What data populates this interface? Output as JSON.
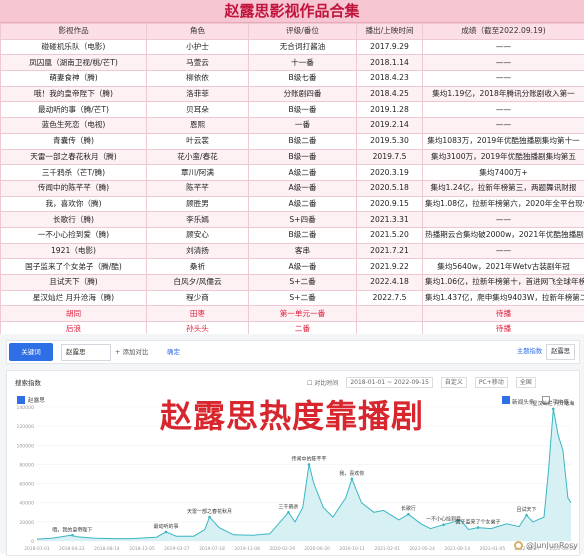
{
  "table": {
    "title": "赵露思影视作品合集",
    "headers": [
      "影视作品",
      "角色",
      "评级/番位",
      "播出/上映时间",
      "成绩（截至2022.09.19)"
    ],
    "rows": [
      [
        "碰碰机乐队（电影)",
        "小护士",
        "无合词打酱油",
        "2017.9.29",
        "——",
        ""
      ],
      [
        "凤囚凰（湖南卫视/桃/芒T)",
        "马萱云",
        "十一番",
        "2018.1.14",
        "——",
        ""
      ],
      [
        "萌妻食神（腾)",
        "柳依依",
        "B级七番",
        "2018.4.23",
        "——",
        ""
      ],
      [
        "哦！我的皇帝陛下（腾)",
        "洛菲菲",
        "分账剧四番",
        "2018.4.25",
        "集均1.19亿，2018年腾讯分账剧收入第一",
        ""
      ],
      [
        "最动听的事（腾/芒T)",
        "贝耳朵",
        "B级一番",
        "2019.1.28",
        "——",
        ""
      ],
      [
        "蓝色生死恋（电视)",
        "恩熙",
        "一番",
        "2019.2.14",
        "——",
        ""
      ],
      [
        "青囊传（腾)",
        "叶云裳",
        "B级二番",
        "2019.5.30",
        "集均1083万，2019年优酷独播剧集均第十一",
        ""
      ],
      [
        "天雷一部之春花秋月（腾)",
        "花小蛮/春花",
        "B级一番",
        "2019.7.5",
        "集均3100万，2019年优酷独播剧集均第五",
        ""
      ],
      [
        "三千鸦杀（芒T/腾)",
        "覃川/阿满",
        "A级二番",
        "2020.3.19",
        "集均7400万+",
        ""
      ],
      [
        "传闻中的陈芊芊（腾)",
        "陈芊芊",
        "A级一番",
        "2020.5.18",
        "集均1.24亿，拉新年榜第三，两题舞讯财报",
        ""
      ],
      [
        "我，喜欢你（腾)",
        "顾胜男",
        "A级二番",
        "2020.9.15",
        "集均1.08亿，拉新年榜第六，2020年全平台现偶年冠",
        ""
      ],
      [
        "长歌行（腾)",
        "李乐嫣",
        "S+四番",
        "2021.3.31",
        "——",
        ""
      ],
      [
        "一不小心捡到爱（腾)",
        "顾安心",
        "B级二番",
        "2021.5.20",
        "热播期云合集均破2000w，2021年优酷独播剧热播期集均第三",
        ""
      ],
      [
        "1921（电影)",
        "刘清扬",
        "客串",
        "2021.7.21",
        "——",
        ""
      ],
      [
        "国子监来了个女弟子（腾/酷)",
        "桑祈",
        "A级一番",
        "2021.9.22",
        "集均5640w，2021年Wetv古装剧年冠",
        ""
      ],
      [
        "且试天下（腾)",
        "白风夕/风儒云",
        "S+二番",
        "2022.4.18",
        "集均1.06亿，拉新年榜第十，首进网飞全球年榜的国产剧",
        ""
      ],
      [
        "星汉灿烂 月升沧海（腾)",
        "程少商",
        "S+二番",
        "2022.7.5",
        "集均1.437亿，爬申集均9403W，拉新年榜第二",
        ""
      ],
      [
        "胡同",
        "田枣",
        "第一单元一番",
        "",
        "待播",
        "red"
      ],
      [
        "后浪",
        "孙头头",
        "二番",
        "",
        "待播",
        "red"
      ]
    ]
  },
  "search_bar": {
    "tab_label": "关键词",
    "keyword": "赵露思",
    "add_label": "+ 添加对比",
    "confirm_label": "确定",
    "right_label": "主题指数",
    "right_keyword": "赵露思"
  },
  "chart_panel": {
    "title": "搜索指数",
    "controls": [
      "对比时间",
      "2018-01-01 ~ 2022-09-15",
      "自定义",
      "PC+移动",
      "全国"
    ],
    "legend_main": "赵露思",
    "legend_right": [
      "新闻头条",
      "平均值"
    ]
  },
  "overlay_text": "赵露思热度靠播剧",
  "watermark": "@JunJunRosy",
  "colors": {
    "line": "#3bb6c4",
    "fill": "#d6f0f3",
    "title_red": "#c0143c",
    "overlay_red": "#d7262d",
    "accent_blue": "#2f6fe6"
  },
  "chart_data": {
    "type": "area",
    "title": "搜索指数",
    "series_name": "赵露思",
    "x_ticks": [
      "2018-01-01",
      "2018-04-23",
      "2018-08-14",
      "2018-12-05",
      "2019-03-27",
      "2019-07-18",
      "2019-11-08",
      "2020-02-29",
      "2020-06-20",
      "2020-10-11",
      "2021-02-01",
      "2021-05-24",
      "2021-09-14",
      "2022-01-05",
      "2022-04-27",
      "2022-08-18"
    ],
    "y_ticks": [
      0,
      20000,
      40000,
      60000,
      80000,
      100000,
      120000,
      140000
    ],
    "ylim": [
      0,
      140000
    ],
    "xlim": [
      "2018-01-01",
      "2022-09-15"
    ],
    "points": [
      [
        "2018-01-01",
        2000
      ],
      [
        "2018-02-20",
        3000
      ],
      [
        "2018-04-20",
        6000
      ],
      [
        "2018-05-10",
        4500
      ],
      [
        "2018-07-01",
        3000
      ],
      [
        "2018-09-01",
        2500
      ],
      [
        "2018-11-01",
        2500
      ],
      [
        "2019-01-20",
        4000
      ],
      [
        "2019-02-20",
        9500
      ],
      [
        "2019-03-25",
        5000
      ],
      [
        "2019-05-20",
        5000
      ],
      [
        "2019-06-25",
        12000
      ],
      [
        "2019-07-10",
        25000
      ],
      [
        "2019-08-10",
        14000
      ],
      [
        "2019-09-25",
        6500
      ],
      [
        "2019-11-25",
        6000
      ],
      [
        "2020-01-20",
        7500
      ],
      [
        "2020-03-20",
        30000
      ],
      [
        "2020-04-10",
        20000
      ],
      [
        "2020-05-05",
        35000
      ],
      [
        "2020-05-25",
        80000
      ],
      [
        "2020-06-10",
        60000
      ],
      [
        "2020-07-10",
        35000
      ],
      [
        "2020-08-10",
        25000
      ],
      [
        "2020-09-20",
        45000
      ],
      [
        "2020-10-10",
        65000
      ],
      [
        "2020-11-10",
        40000
      ],
      [
        "2020-12-20",
        30000
      ],
      [
        "2021-01-20",
        32000
      ],
      [
        "2021-03-10",
        22000
      ],
      [
        "2021-04-10",
        28000
      ],
      [
        "2021-05-20",
        18000
      ],
      [
        "2021-06-20",
        13000
      ],
      [
        "2021-08-01",
        17000
      ],
      [
        "2021-09-25",
        22000
      ],
      [
        "2021-10-20",
        12000
      ],
      [
        "2021-11-20",
        14000
      ],
      [
        "2022-01-01",
        13000
      ],
      [
        "2022-02-20",
        18000
      ],
      [
        "2022-04-01",
        15000
      ],
      [
        "2022-04-25",
        27000
      ],
      [
        "2022-05-15",
        20000
      ],
      [
        "2022-06-20",
        25000
      ],
      [
        "2022-07-05",
        75000
      ],
      [
        "2022-07-20",
        138000
      ],
      [
        "2022-08-05",
        110000
      ],
      [
        "2022-08-20",
        95000
      ],
      [
        "2022-09-05",
        45000
      ],
      [
        "2022-09-15",
        40000
      ]
    ],
    "annotations": [
      {
        "text": "哦，我的皇帝陛下",
        "x": "2018-04-25",
        "y": 6000
      },
      {
        "text": "最动听的事",
        "x": "2019-02-20",
        "y": 9500
      },
      {
        "text": "天雷一部之春花秋月",
        "x": "2019-07-10",
        "y": 25000
      },
      {
        "text": "三千鸦杀",
        "x": "2020-03-20",
        "y": 30000
      },
      {
        "text": "传闻中的陈芊芊",
        "x": "2020-05-25",
        "y": 80000
      },
      {
        "text": "我，喜欢你",
        "x": "2020-10-10",
        "y": 65000
      },
      {
        "text": "长歌行",
        "x": "2021-04-10",
        "y": 28000
      },
      {
        "text": "一不小心捡到爱",
        "x": "2021-08-01",
        "y": 17000
      },
      {
        "text": "国子监来了个女弟子",
        "x": "2021-11-20",
        "y": 14000
      },
      {
        "text": "且试天下",
        "x": "2022-04-25",
        "y": 27000
      },
      {
        "text": "星汉灿烂 月升沧海",
        "x": "2022-07-20",
        "y": 138000
      }
    ]
  }
}
